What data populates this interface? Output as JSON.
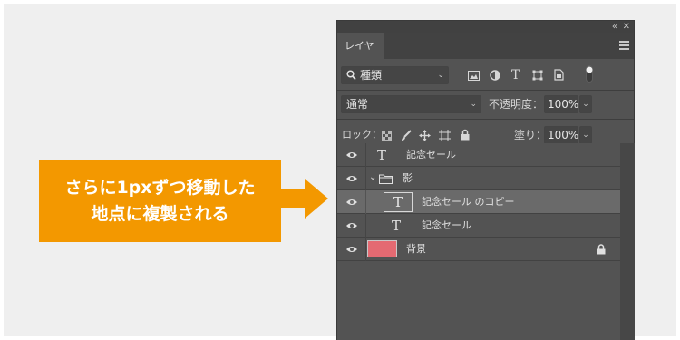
{
  "callout": {
    "line1": "さらに1pxずつ移動した",
    "line2": "地点に複製される",
    "color": "#f39800"
  },
  "panel": {
    "collapse_icon": "«",
    "close_icon": "✕",
    "tab_label": "レイヤー",
    "filter": {
      "search_icon": "search-icon",
      "kind_label": "種類",
      "filter_icons": [
        "image-filter-icon",
        "adjustment-filter-icon",
        "type-filter-icon",
        "shape-filter-icon",
        "smart-object-filter-icon",
        "filter-toggle-icon"
      ]
    },
    "blend": {
      "mode": "通常",
      "opacity_label": "不透明度：",
      "opacity_value": "100%"
    },
    "lock": {
      "label": "ロック：",
      "fill_label": "塗り：",
      "fill_value": "100%"
    },
    "layers": [
      {
        "name": "記念セール",
        "type": "text",
        "selected": false
      },
      {
        "name": "影",
        "type": "group",
        "expanded": true
      },
      {
        "name": "記念セール のコピー",
        "type": "text",
        "selected": true
      },
      {
        "name": "記念セール",
        "type": "text",
        "selected": false
      },
      {
        "name": "背景",
        "type": "background",
        "swatch": "#e46a72",
        "locked": true
      }
    ]
  }
}
